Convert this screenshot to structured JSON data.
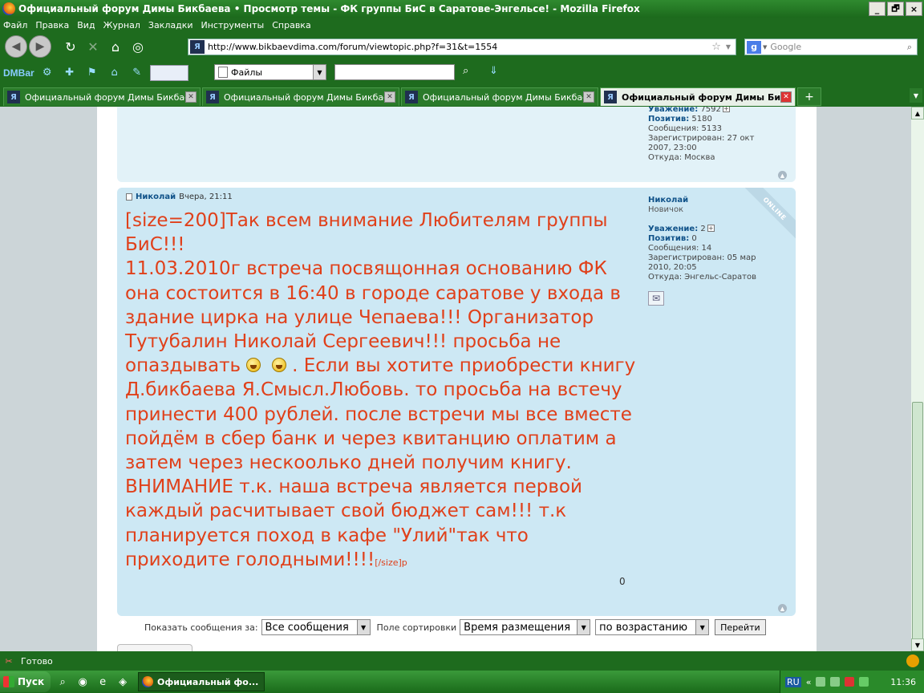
{
  "window": {
    "title": "Официальный форум Димы Бикбаева • Просмотр темы - ФК группы БиС в Саратове-Энгельсе! - Mozilla Firefox",
    "buttons": [
      "_",
      "🗗",
      "×"
    ]
  },
  "menu": [
    "Файл",
    "Правка",
    "Вид",
    "Журнал",
    "Закладки",
    "Инструменты",
    "Справка"
  ],
  "nav": {
    "url": "http://www.bikbaevdima.com/forum/viewtopic.php?f=31&t=1554",
    "search_placeholder": "Google"
  },
  "dmbar": {
    "logo": "DMBar",
    "files_label": "Файлы"
  },
  "tabs": [
    {
      "label": "Официальный форум Димы Бикбаева...",
      "active": false
    },
    {
      "label": "Официальный форум Димы Бикбаев...",
      "active": false
    },
    {
      "label": "Официальный форум Димы Бикбаев...",
      "active": false
    },
    {
      "label": "Официальный форум Димы Бик...",
      "active": true
    }
  ],
  "post1_profile": {
    "respect_label": "Уважение:",
    "respect_value": "7592",
    "positive_label": "Позитив:",
    "positive_value": "5180",
    "messages": "Сообщения: 5133",
    "registered_line1": "Зарегистрирован: 27 окт",
    "registered_line2": "2007, 23:00",
    "from": "Откуда: Москва"
  },
  "post2": {
    "author": "Николай",
    "time": "Вчера, 21:11",
    "online": "ONLINE",
    "text_lines": [
      "[size=200]Так всем внимание Любителям группы БиС!!!",
      "11.03.2010г встреча посвящонная основанию ФК она состоится в 16:40 в городе саратове у входа в здание цирка на улице Чепаева!!! Организатор Тутубалин Николай Сергеевич!!! просьба не опаздывать"
    ],
    "text_after_smileys": ". Если вы хотите приобрести книгу Д.бикбаева Я.Смысл.Любовь. то просьба на встечу принести 400 рублей. после встречи мы все вместе пойдём в сбер банк и через квитанцию оплатим а затем через нескоолько дней получим книгу. ВНИМАНИЕ т.к. наша встреча является первой каждый расчитывает свой бюджет сам!!! т.к планируется поход в кафе \"Улий\"так что приходите голодными!!!!",
    "text_tail": "[/size]p",
    "zero": "0",
    "profile": {
      "name": "Николай",
      "rank": "Новичок",
      "respect_label": "Уважение:",
      "respect_value": "2",
      "positive_label": "Позитив:",
      "positive_value": "0",
      "messages": "Сообщения: 14",
      "registered_line1": "Зарегистрирован: 05 мар",
      "registered_line2": "2010, 20:05",
      "from": "Откуда: Энгельс-Саратов"
    }
  },
  "sort": {
    "show_label": "Показать сообщения за:",
    "show_value": "Все сообщения",
    "field_label": "Поле сортировки",
    "field_value": "Время размещения",
    "order_value": "по возрастанию",
    "go_label": "Перейти"
  },
  "status": {
    "text": "Готово"
  },
  "taskbar": {
    "start": "Пуск",
    "item": "Официальный фо...",
    "lang": "RU",
    "clock": "11:36"
  }
}
